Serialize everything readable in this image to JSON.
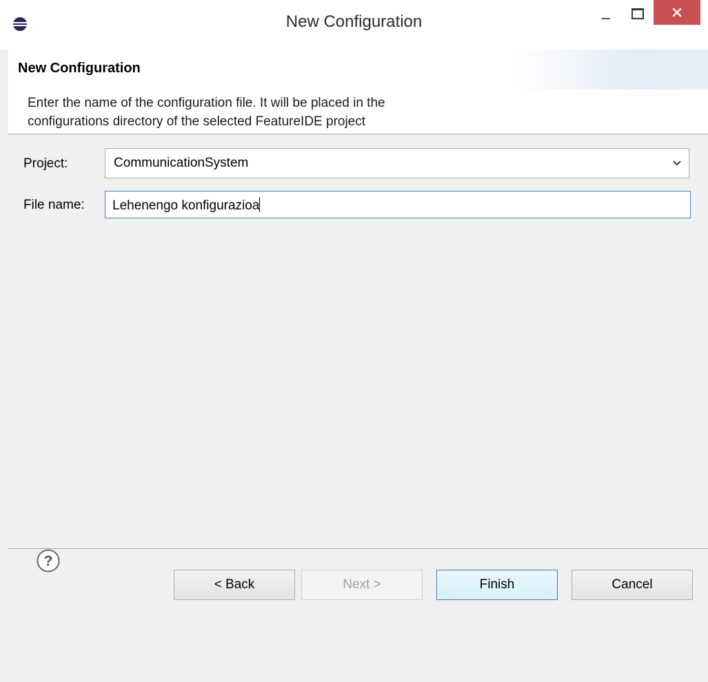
{
  "window": {
    "title": "New Configuration",
    "close_color": "#c75050"
  },
  "icons": {
    "app": "eclipse-icon",
    "minimize": "minimize-icon",
    "maximize": "maximize-icon",
    "close": "close-icon",
    "help": "help-icon",
    "dropdown": "chevron-down-icon"
  },
  "header": {
    "title": "New Configuration",
    "description_line1": "Enter the name of the configuration file. It will be placed in the",
    "description_line2": "configurations directory of the selected FeatureIDE project"
  },
  "form": {
    "project_label": "Project:",
    "project_value": "CommunicationSystem",
    "filename_label": "File name:",
    "filename_value": "Lehenengo konfigurazioa"
  },
  "buttons": {
    "back": "< Back",
    "next": "Next >",
    "finish": "Finish",
    "cancel": "Cancel"
  }
}
